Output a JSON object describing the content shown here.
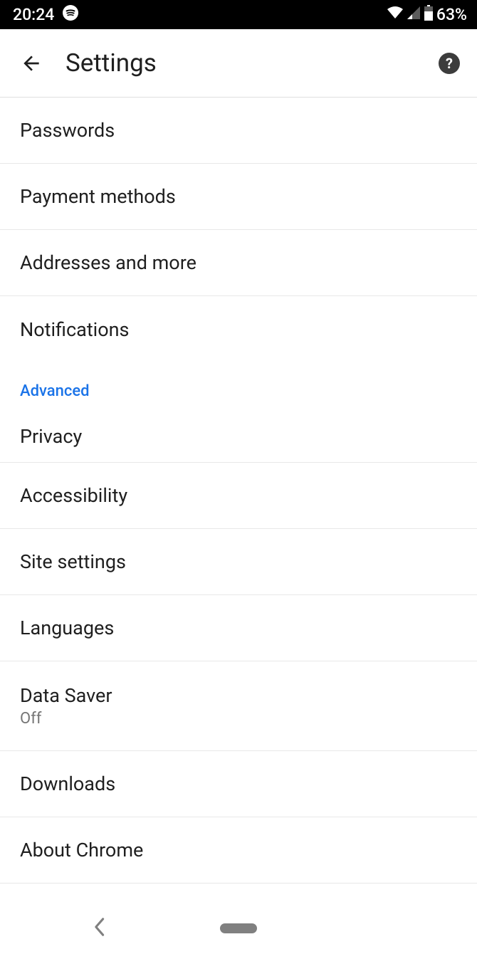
{
  "statusBar": {
    "time": "20:24",
    "battery": "63%"
  },
  "appBar": {
    "title": "Settings"
  },
  "basicItems": [
    {
      "label": "Passwords"
    },
    {
      "label": "Payment methods"
    },
    {
      "label": "Addresses and more"
    },
    {
      "label": "Notifications"
    }
  ],
  "sectionHeader": "Advanced",
  "advancedItems": [
    {
      "label": "Privacy"
    },
    {
      "label": "Accessibility"
    },
    {
      "label": "Site settings"
    },
    {
      "label": "Languages"
    },
    {
      "label": "Data Saver",
      "sub": "Off"
    },
    {
      "label": "Downloads"
    },
    {
      "label": "About Chrome"
    }
  ]
}
